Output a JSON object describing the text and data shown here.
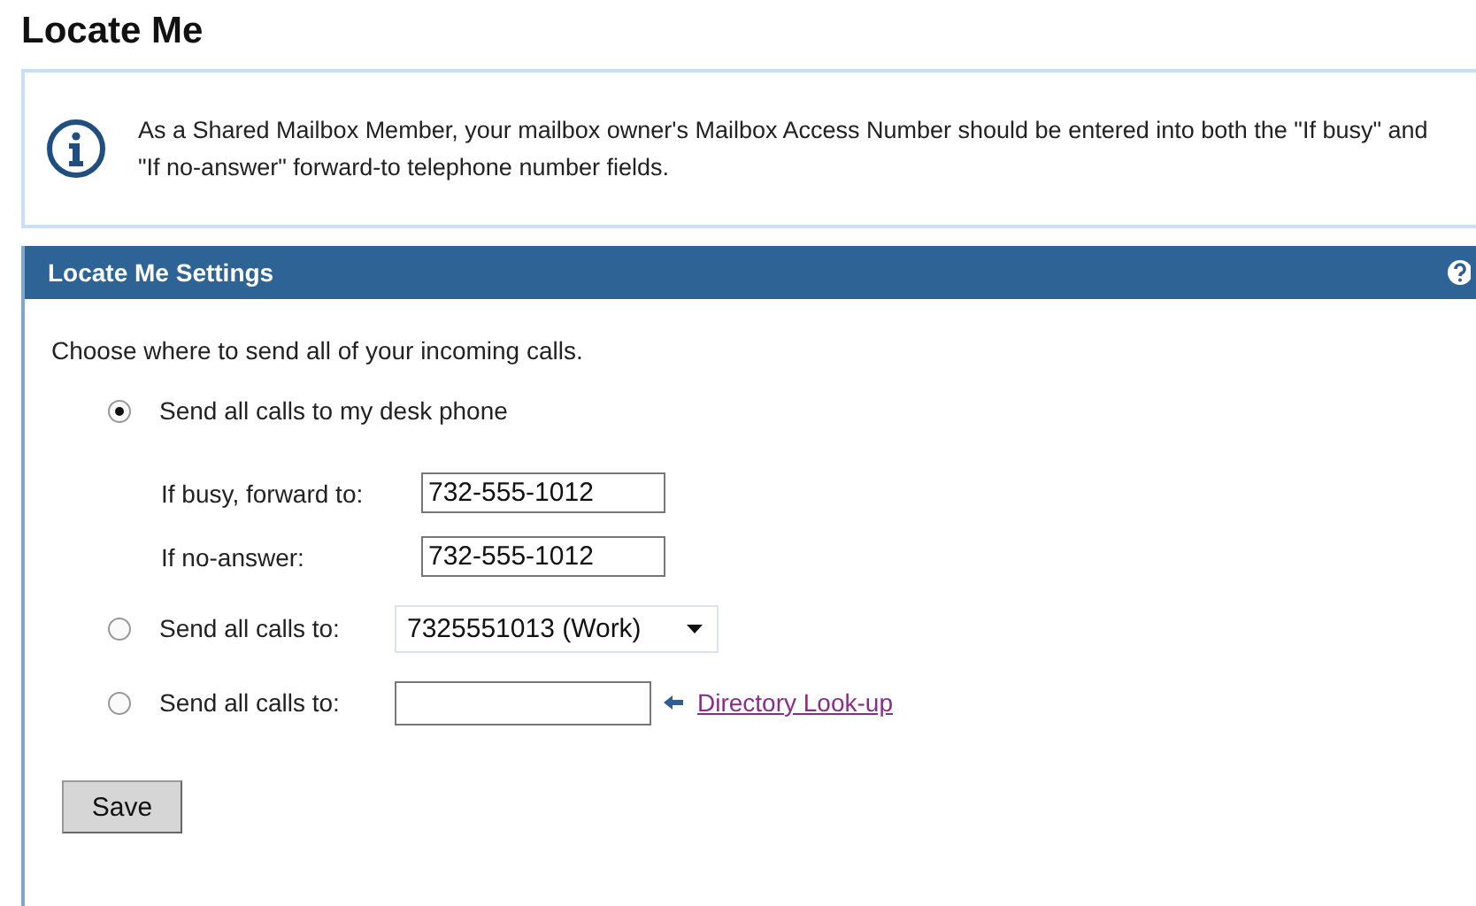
{
  "page_title": "Locate Me",
  "info": {
    "text": "As a Shared Mailbox Member, your mailbox owner's Mailbox Access Number should be entered into both the \"If busy\" and \"If no-answer\" forward-to telephone number fields."
  },
  "panel": {
    "title": "Locate Me Settings",
    "intro": "Choose where to send all of your incoming calls.",
    "options": [
      {
        "kind": "desk",
        "label": "Send all calls to my desk phone",
        "selected": true,
        "fields": [
          {
            "label": "If busy, forward to:",
            "value": "732-555-1012"
          },
          {
            "label": "If no-answer:",
            "value": "732-555-1012"
          }
        ]
      },
      {
        "kind": "select",
        "label": "Send all calls to:",
        "selected": false,
        "value": "7325551013 (Work)"
      },
      {
        "kind": "input",
        "label": "Send all calls to:",
        "selected": false,
        "link": "Directory Look-up"
      }
    ],
    "save": "Save"
  }
}
